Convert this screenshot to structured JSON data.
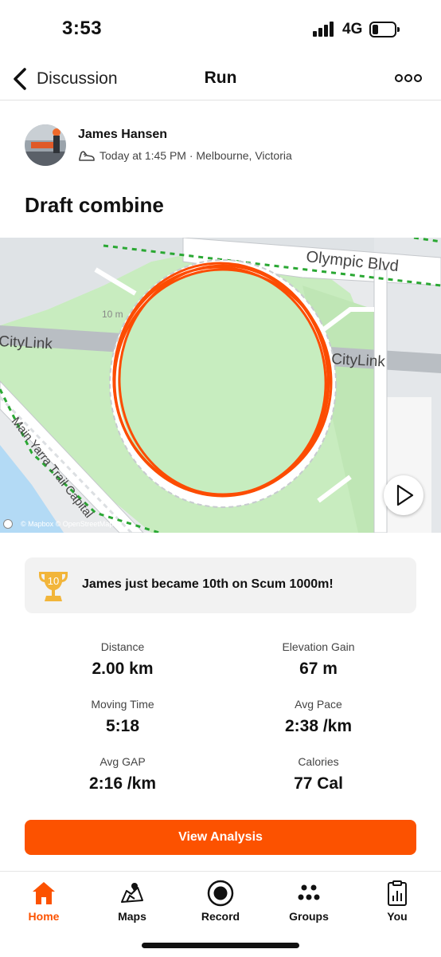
{
  "status_bar": {
    "time": "3:53",
    "network": "4G",
    "battery_level": 0.25
  },
  "header": {
    "back_label": "Discussion",
    "title": "Run",
    "back_icon": "chevron-left-icon",
    "more_icon": "more-dots-icon"
  },
  "author": {
    "name": "James Hansen",
    "meta": "Today at 1:45 PM · Melbourne, Victoria",
    "activity_icon": "running-shoe-icon"
  },
  "activity": {
    "title": "Draft combine"
  },
  "map": {
    "labels": {
      "road_top": "Olympic Blvd",
      "road_left": "CityLink",
      "road_right": "CityLink",
      "trail": "Main Yarra Trail Capital",
      "distance_marker": "10 m"
    },
    "attribution": "© Mapbox © OpenStreetMap",
    "route_color": "#fc4c02"
  },
  "achievement": {
    "text": "James just became 10th on Scum 1000m!",
    "badge": "10",
    "icon": "trophy-icon"
  },
  "stats": [
    {
      "label": "Distance",
      "value": "2.00 km"
    },
    {
      "label": "Elevation Gain",
      "value": "67 m"
    },
    {
      "label": "Moving Time",
      "value": "5:18"
    },
    {
      "label": "Avg Pace",
      "value": "2:38 /km"
    },
    {
      "label": "Avg GAP",
      "value": "2:16 /km"
    },
    {
      "label": "Calories",
      "value": "77 Cal"
    }
  ],
  "cta": {
    "label": "View Analysis"
  },
  "tabs": [
    {
      "label": "Home",
      "icon": "home-icon",
      "active": true
    },
    {
      "label": "Maps",
      "icon": "map-icon",
      "active": false
    },
    {
      "label": "Record",
      "icon": "record-icon",
      "active": false
    },
    {
      "label": "Groups",
      "icon": "groups-icon",
      "active": false
    },
    {
      "label": "You",
      "icon": "you-icon",
      "active": false
    }
  ],
  "colors": {
    "accent": "#fc5200",
    "map_green": "#c8ecbf",
    "road_gray": "#c4c8cc",
    "water": "#b3daf5"
  }
}
